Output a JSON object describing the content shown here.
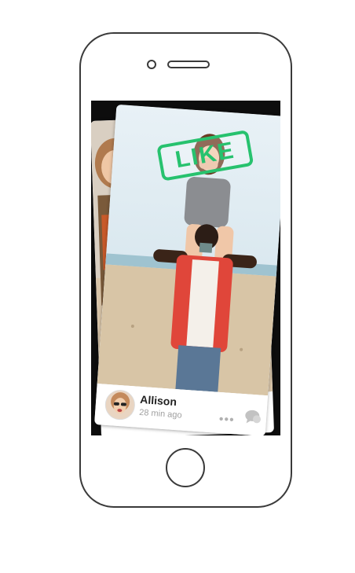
{
  "stamp": {
    "label": "LIKE",
    "color": "#27c26e"
  },
  "profile": {
    "name": "Allison",
    "time": "28 min ago"
  },
  "footer": {
    "more_icon": "more-dots-icon",
    "chat_icon": "chat-bubble-icon",
    "more_label": "•••"
  },
  "colors": {
    "frame": "#3a3a3a",
    "screen": "#0d0d0d",
    "accent": "#27c26e"
  }
}
